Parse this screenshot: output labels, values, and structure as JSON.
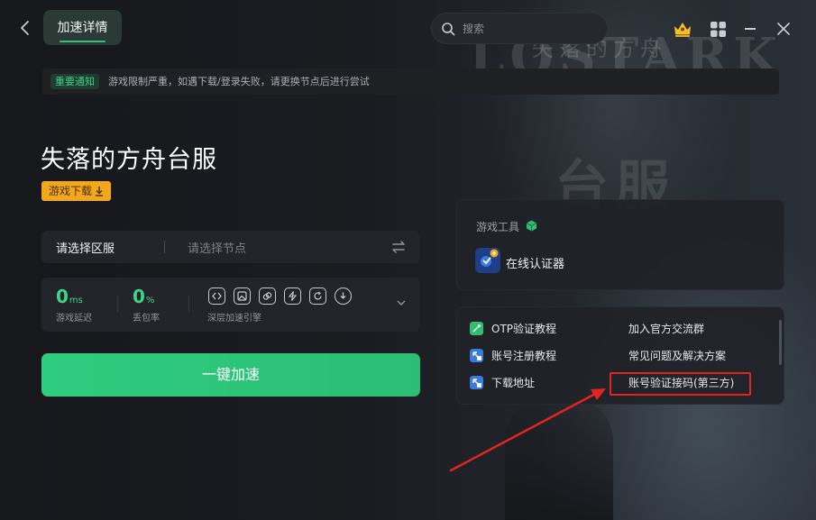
{
  "header": {
    "active_tab": "加速详情",
    "search_placeholder": "搜索"
  },
  "notice": {
    "tag": "重要通知",
    "text": "游戏限制严重，如遇下载/登录失败，请更换节点后进行尝试"
  },
  "background_art": {
    "top_text": "失落的方舟",
    "logo_text": "LOSTARK",
    "sub_text": "台服"
  },
  "game": {
    "title": "失落的方舟台服",
    "download_label": "游戏下载"
  },
  "selector": {
    "region_label": "请选择区服",
    "node_placeholder": "请选择节点"
  },
  "stats": {
    "latency_value": "0",
    "latency_unit": "ms",
    "latency_label": "游戏延迟",
    "loss_value": "0",
    "loss_unit": "%",
    "loss_label": "丢包率",
    "engine_label": "深层加速引擎",
    "engine_icons": [
      "code-icon",
      "image-icon",
      "link-icon",
      "bolt-icon",
      "refresh-icon",
      "download-circle-icon"
    ]
  },
  "accelerate": {
    "label": "一键加速"
  },
  "tools": {
    "title": "游戏工具",
    "items": [
      {
        "label": "在线认证器",
        "icon": "authenticator-app-icon"
      }
    ]
  },
  "links": {
    "left": [
      {
        "label": "OTP验证教程",
        "icon": "otp-icon"
      },
      {
        "label": "账号注册教程",
        "icon": "register-icon"
      },
      {
        "label": "下载地址",
        "icon": "download-link-icon"
      }
    ],
    "right": [
      {
        "label": "加入官方交流群"
      },
      {
        "label": "常见问题及解决方案"
      },
      {
        "label": "账号验证接码(第三方)"
      }
    ]
  },
  "colors": {
    "accent_green": "#2ecc7e",
    "download_orange": "#f3a81b",
    "highlight_red": "#e3241e"
  }
}
